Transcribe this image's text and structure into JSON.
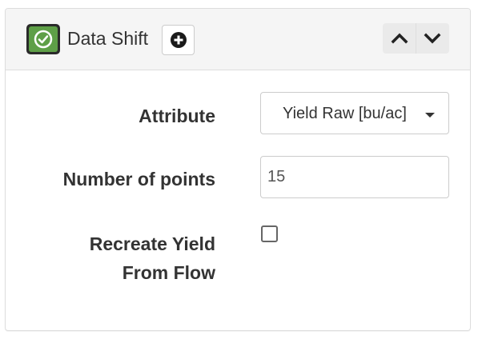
{
  "panel": {
    "title": "Data Shift",
    "status_icon": "check-circle-icon",
    "status_color": "#5e9f47",
    "add_icon": "plus-circle-icon",
    "collapse_up_icon": "chevron-up-icon",
    "collapse_down_icon": "chevron-down-icon"
  },
  "form": {
    "attribute": {
      "label": "Attribute",
      "selected": "Yield Raw [bu/ac]"
    },
    "points": {
      "label": "Number of points",
      "value": "15"
    },
    "recreate": {
      "label_line1": "Recreate Yield",
      "label_line2": "From Flow",
      "checked": false
    }
  }
}
